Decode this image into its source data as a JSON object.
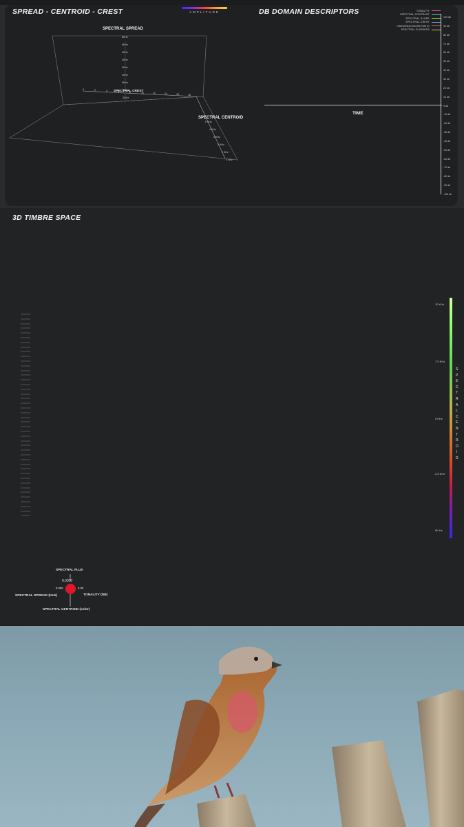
{
  "top_panel": {
    "left_title": "SPREAD - CENTROID - CREST",
    "right_title": "DB DOMAIN DESCRIPTORS",
    "amplitude_label": "AMPLITUDE"
  },
  "legend": [
    {
      "label": "TONALITY",
      "color": "#e24a8b"
    },
    {
      "label": "SPECTRAL CONTRAST",
      "color": "#4ad6c8"
    },
    {
      "label": "SPECTRAL SLOPE",
      "color": "#8be04a"
    },
    {
      "label": "SPECTRAL CREST",
      "color": "#5a8ef0"
    },
    {
      "label": "HARMONIC/NOISE RATIO",
      "color": "#e0703a"
    },
    {
      "label": "SPECTRAL FLATNESS",
      "color": "#e6c84a"
    }
  ],
  "db_ticks": [
    "100 db",
    "90 db",
    "80 db",
    "70 db",
    "60 db",
    "50 db",
    "40 db",
    "30 db",
    "20 db",
    "10 db",
    "0 db",
    "-10 db",
    "-20 db",
    "-30 db",
    "-40 db",
    "-50 db",
    "-60 db",
    "-70 db",
    "-80 db",
    "-90 db",
    "-100 db"
  ],
  "time_label": "TIME",
  "spread_centroid": {
    "spread_label": "SPECTRAL SPREAD",
    "centroid_label": "SPECTRAL CENTROID",
    "crest_label": "SPECTRAL CREST",
    "spread_ticks": [
      "6KHz",
      "5KHz",
      "4KHz",
      "3KHz",
      "2KHz",
      "1KHz",
      "0KHz",
      "-1KHz",
      "-2KHz"
    ],
    "centroid_ticks": [
      "5 KHz",
      "4 KHz",
      "3 KHz",
      "2 KHz",
      "1 KHz",
      "0 KHz"
    ],
    "crest_ticks": [
      "0",
      "2",
      "4",
      "6",
      "8",
      "10",
      "12",
      "14",
      "16",
      "18"
    ]
  },
  "timbre": {
    "title": "3D TIMBRE SPACE",
    "colorbar_ticks": [
      "10 KHz",
      "7.5 KHz",
      "5 KHz",
      "2.5 KHz",
      "0K Hz"
    ],
    "colorbar_title": "SPECTRAL CENTROID",
    "glyph": {
      "flux_label": "SPECTRAL FLUX",
      "flux_value": "0.0000",
      "spread_label": "SPECTRAL SPREAD (KHz)",
      "spread_value": "0.000",
      "tonality_label": "TONALITY (DB)",
      "tonality_value": "0.00",
      "centroid_label": "SPECTRAL CENTROID (color)",
      "dot_color": "#e0162b"
    }
  },
  "photo": {
    "subject": "bird-on-fence-post"
  }
}
